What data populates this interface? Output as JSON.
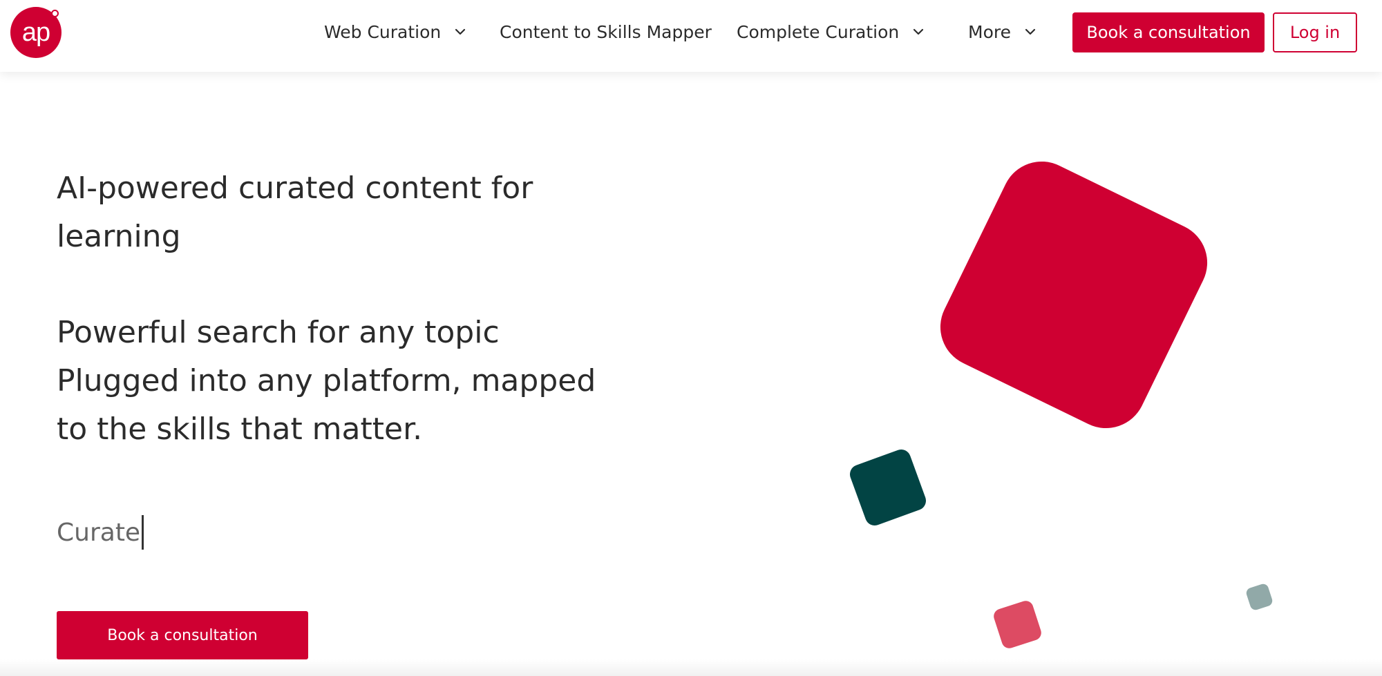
{
  "brand": {
    "logo_text": "ap",
    "accent_color": "#cf0032",
    "teal_color": "#024444",
    "soft_pink_color": "#dd4b63",
    "grey_color": "#91a9a8"
  },
  "nav": {
    "items": [
      {
        "label": "Web Curation",
        "has_dropdown": true
      },
      {
        "label": "Content to Skills Mapper",
        "has_dropdown": false
      },
      {
        "label": "Complete Curation",
        "has_dropdown": true
      },
      {
        "label": "More",
        "has_dropdown": true
      }
    ],
    "cta_label": "Book a consultation",
    "login_label": "Log in"
  },
  "hero": {
    "headline": "AI-powered curated content for learning",
    "lines": [
      "Powerful search for any topic",
      "Plugged into any platform, mapped",
      "to the skills that matter."
    ],
    "typed_text": "Curate",
    "cta_label": "Book a consultation"
  }
}
